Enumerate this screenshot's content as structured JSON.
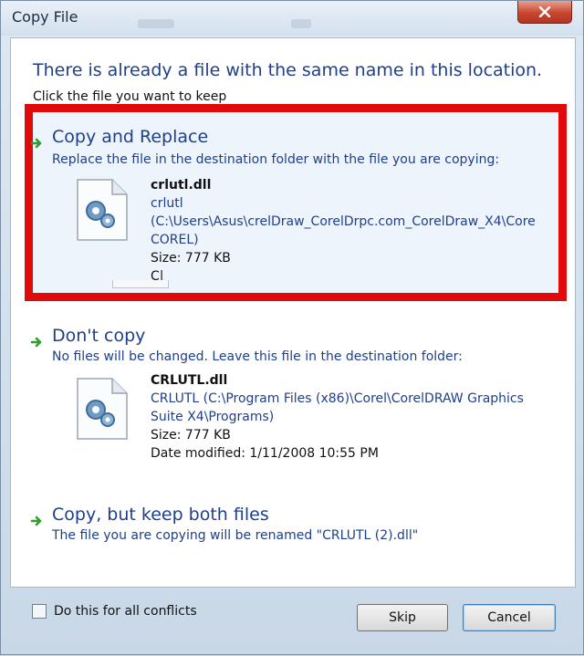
{
  "window": {
    "title": "Copy File",
    "close_icon": "close-x-icon"
  },
  "header": {
    "heading": "There is already a file with the same name in this location.",
    "subheading": "Click the file you want to keep"
  },
  "options": [
    {
      "title": "Copy and Replace",
      "description": "Replace the file in the destination folder with the file you are copying:",
      "icon": "green-arrow-icon",
      "highlighted": true,
      "file": {
        "name": "crlutl.dll",
        "line1": "crlutl",
        "line2": "(C:\\Users\\Asus\\crelDraw_CorelDrpc.com_CorelDraw_X4\\Core",
        "line3": "COREL)",
        "size": "Size: 777 KB",
        "extra": "C|"
      }
    },
    {
      "title": "Don't copy",
      "description": "No files will be changed. Leave this file in the destination folder:",
      "icon": "green-arrow-icon",
      "file": {
        "name": "CRLUTL.dll",
        "line1": "CRLUTL (C:\\Program Files (x86)\\Corel\\CorelDRAW Graphics",
        "line2": "Suite X4\\Programs)",
        "size": "Size: 777 KB",
        "modified": "Date modified: 1/11/2008 10:55 PM"
      }
    },
    {
      "title": "Copy, but keep both files",
      "description": "The file you are copying will be renamed \"CRLUTL (2).dll\"",
      "icon": "green-arrow-icon"
    }
  ],
  "footer": {
    "checkbox_label": "Do this for all conflicts",
    "checkbox_checked": false,
    "skip_label": "Skip",
    "cancel_label": "Cancel"
  },
  "colors": {
    "accent_text": "#1e3f8a",
    "highlight_border": "#e00a0a",
    "arrow_green": "#2f9e2f"
  }
}
